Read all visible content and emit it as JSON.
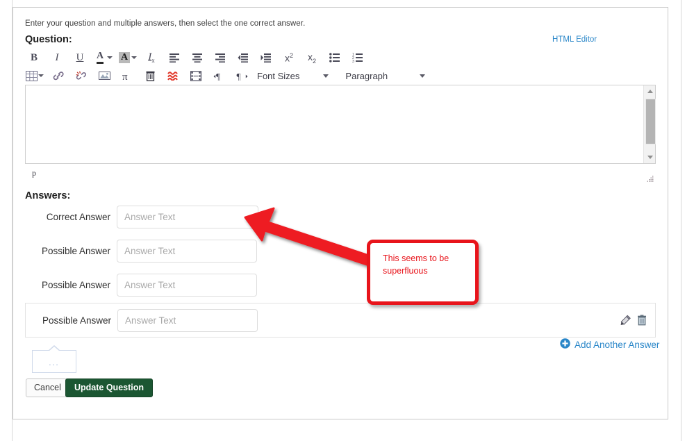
{
  "instructions": "Enter your question and multiple answers, then select the one correct answer.",
  "question": {
    "label": "Question:",
    "html_editor_link": "HTML Editor",
    "status_path": "p",
    "body_text": ""
  },
  "toolbar": {
    "row1": [
      {
        "name": "bold-icon",
        "label": "B"
      },
      {
        "name": "italic-icon",
        "label": "I"
      },
      {
        "name": "underline-icon",
        "label": "U"
      },
      {
        "name": "text-color-icon",
        "label": "A"
      },
      {
        "name": "text-color-caret-icon",
        "label": ""
      },
      {
        "name": "background-color-icon",
        "label": "A"
      },
      {
        "name": "background-color-caret-icon",
        "label": ""
      },
      {
        "name": "remove-formatting-icon",
        "label": "Tx"
      },
      {
        "name": "align-left-icon",
        "label": ""
      },
      {
        "name": "align-center-icon",
        "label": ""
      },
      {
        "name": "align-right-icon",
        "label": ""
      },
      {
        "name": "outdent-icon",
        "label": ""
      },
      {
        "name": "indent-icon",
        "label": ""
      },
      {
        "name": "superscript-icon",
        "label": "x2"
      },
      {
        "name": "subscript-icon",
        "label": "x2"
      },
      {
        "name": "bullet-list-icon",
        "label": ""
      },
      {
        "name": "numbered-list-icon",
        "label": ""
      }
    ],
    "row2": [
      {
        "name": "table-icon",
        "label": ""
      },
      {
        "name": "table-caret-icon",
        "label": ""
      },
      {
        "name": "insert-link-icon",
        "label": ""
      },
      {
        "name": "unlink-icon",
        "label": ""
      },
      {
        "name": "insert-image-icon",
        "label": ""
      },
      {
        "name": "math-equation-icon",
        "label": ""
      },
      {
        "name": "delete-icon",
        "label": ""
      },
      {
        "name": "kaltura-media-icon",
        "label": ""
      },
      {
        "name": "insert-video-icon",
        "label": ""
      },
      {
        "name": "ltr-direction-icon",
        "label": ""
      },
      {
        "name": "rtl-direction-icon",
        "label": ""
      }
    ],
    "font_sizes_label": "Font Sizes",
    "paragraph_label": "Paragraph"
  },
  "answers": {
    "heading": "Answers:",
    "placeholder": "Answer Text",
    "rows": [
      {
        "label": "Correct Answer",
        "value": "",
        "kind": "correct"
      },
      {
        "label": "Possible Answer",
        "value": "",
        "kind": "possible"
      },
      {
        "label": "Possible Answer",
        "value": "",
        "kind": "possible"
      },
      {
        "label": "Possible Answer",
        "value": "",
        "kind": "possible"
      }
    ],
    "add_another_label": "Add Another Answer",
    "edit_icon_name": "edit-pencil-icon",
    "delete_icon_name": "trash-icon"
  },
  "stub": {
    "dots": "..."
  },
  "footer": {
    "cancel_label": "Cancel",
    "update_label": "Update Question"
  },
  "annotation": {
    "text": "This seems to be superfluous",
    "color": "#e8141b"
  },
  "colors": {
    "link": "#2986c8",
    "primary_button": "#1b5632",
    "annotation_red": "#e8141b",
    "border": "#cfcfcf"
  }
}
